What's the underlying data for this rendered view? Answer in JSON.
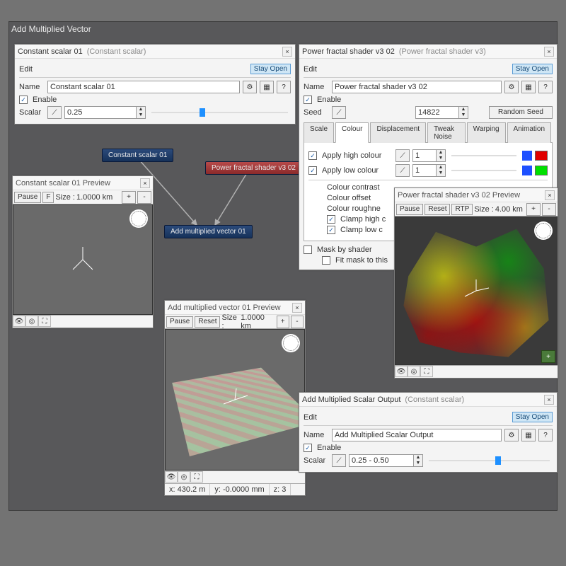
{
  "app": {
    "title": "Add Multiplied Vector"
  },
  "common": {
    "edit": "Edit",
    "stay_open": "Stay Open",
    "name_label": "Name",
    "enable": "Enable",
    "help": "?"
  },
  "nodes": {
    "const": "Constant scalar 01",
    "fractal": "Power fractal shader v3 02",
    "addmul": "Add multiplied vector 01"
  },
  "const_panel": {
    "title": "Constant scalar 01",
    "type": "(Constant scalar)",
    "name": "Constant scalar 01",
    "scalar_label": "Scalar",
    "scalar_value": "0.25"
  },
  "const_preview": {
    "title": "Constant scalar 01 Preview",
    "pause": "Pause",
    "f": "F",
    "size_label": "Size :",
    "size_value": "1.0000 km"
  },
  "addmul_preview": {
    "title": "Add multiplied vector 01 Preview",
    "pause": "Pause",
    "reset": "Reset",
    "size_label": "Size :",
    "size_value": "1.0000 km",
    "status_x": "x: 430.2 m",
    "status_y": "y: -0.0000 mm",
    "status_z": "z: 3"
  },
  "fractal_panel": {
    "title": "Power fractal shader v3 02",
    "type": "(Power fractal shader v3)",
    "name": "Power fractal shader v3 02",
    "seed_label": "Seed",
    "seed_value": "14822",
    "random_seed": "Random Seed",
    "tabs": [
      "Scale",
      "Colour",
      "Displacement",
      "Tweak Noise",
      "Warping",
      "Animation"
    ],
    "apply_high": "Apply high colour",
    "apply_low": "Apply low colour",
    "high_val": "1",
    "low_val": "1",
    "colour_contrast": "Colour contrast",
    "colour_offset": "Colour offset",
    "colour_roughness": "Colour roughne",
    "clamp_high": "Clamp high c",
    "clamp_low": "Clamp low c",
    "mask": "Mask by shader",
    "fitmask": "Fit mask to this"
  },
  "fractal_preview": {
    "title": "Power fractal shader v3 02 Preview",
    "pause": "Pause",
    "reset": "Reset",
    "rtp": "RTP",
    "size_label": "Size :",
    "size_value": "4.00 km"
  },
  "output_panel": {
    "title": "Add Multiplied Scalar Output",
    "type": "(Constant scalar)",
    "name": "Add Multiplied Scalar Output",
    "scalar_label": "Scalar",
    "scalar_value": "0.25 - 0.50"
  }
}
